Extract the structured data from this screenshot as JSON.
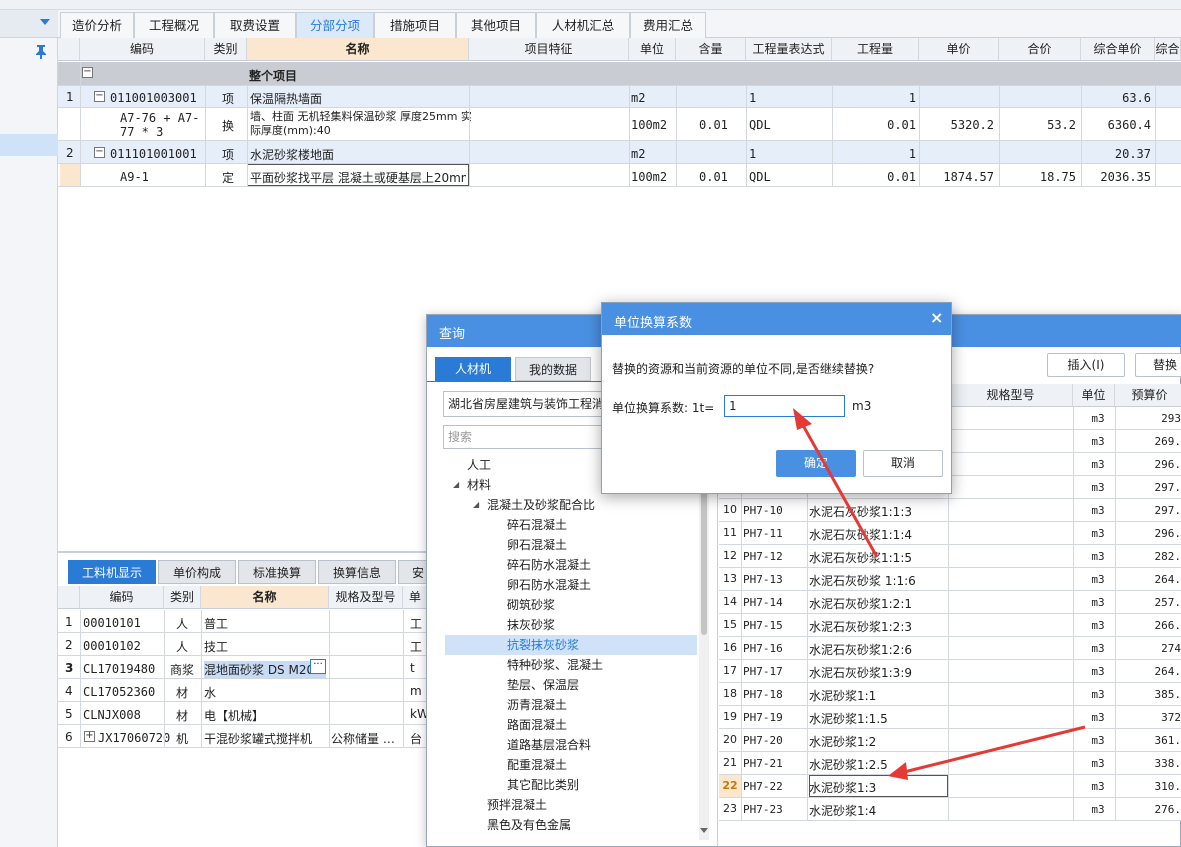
{
  "top_tabs": [
    {
      "label": "造价分析"
    },
    {
      "label": "工程概况"
    },
    {
      "label": "取费设置"
    },
    {
      "label": "分部分项"
    },
    {
      "label": "措施项目"
    },
    {
      "label": "其他项目"
    },
    {
      "label": "人材机汇总"
    },
    {
      "label": "费用汇总"
    }
  ],
  "active_top_tab": "分部分项",
  "grid": {
    "headers": [
      "编码",
      "类别",
      "名称",
      "项目特征",
      "单位",
      "含量",
      "工程量表达式",
      "工程量",
      "单价",
      "合价",
      "综合单价",
      "综合"
    ],
    "group_title": "整个项目",
    "rows": [
      {
        "no": "1",
        "code": "011001003001",
        "cat": "项",
        "name": "保温隔热墙面",
        "unit": "m2",
        "content": "",
        "expr": "1",
        "qty": "1",
        "price": "",
        "total": "",
        "uprice": "63.6"
      },
      {
        "no": "",
        "code": "A7-76 + A7-77 * 3",
        "cat": "换",
        "name": "墙、柱面 无机轻集料保温砂浆 厚度25mm 实际厚度(mm):40",
        "unit": "100m2",
        "content": "0.01",
        "expr": "QDL",
        "qty": "0.01",
        "price": "5320.2",
        "total": "53.2",
        "uprice": "6360.4"
      },
      {
        "no": "2",
        "code": "011101001001",
        "cat": "项",
        "name": "水泥砂浆楼地面",
        "unit": "m2",
        "content": "",
        "expr": "1",
        "qty": "1",
        "price": "",
        "total": "",
        "uprice": "20.37"
      },
      {
        "no": "",
        "code": "A9-1",
        "cat": "定",
        "name": "平面砂浆找平层 混凝土或硬基层上20mm",
        "unit": "100m2",
        "content": "0.01",
        "expr": "QDL",
        "qty": "0.01",
        "price": "1874.57",
        "total": "18.75",
        "uprice": "2036.35"
      }
    ]
  },
  "bottom": {
    "tabs": [
      "工料机显示",
      "单价构成",
      "标准换算",
      "换算信息",
      "安"
    ],
    "headers": [
      "编码",
      "类别",
      "名称",
      "规格及型号",
      "单"
    ],
    "rows": [
      {
        "no": "1",
        "code": "00010101",
        "cat": "人",
        "name": "普工",
        "spec": "",
        "unit": "工"
      },
      {
        "no": "2",
        "code": "00010102",
        "cat": "人",
        "name": "技工",
        "spec": "",
        "unit": "工"
      },
      {
        "no": "3",
        "code": "CL17019480",
        "cat": "商浆",
        "name": "混地面砂浆 DS M20",
        "spec": "",
        "unit": "t"
      },
      {
        "no": "4",
        "code": "CL17052360",
        "cat": "材",
        "name": "水",
        "spec": "",
        "unit": "m"
      },
      {
        "no": "5",
        "code": "CLNJX008",
        "cat": "材",
        "name": "电【机械】",
        "spec": "",
        "unit": "kW"
      },
      {
        "no": "6",
        "code": "JX17060720",
        "cat": "机",
        "name": "干混砂浆罐式搅拌机",
        "spec": "公称储量 …",
        "unit": "台"
      }
    ]
  },
  "query": {
    "title": "查询",
    "tabs": [
      "人材机",
      "我的数据"
    ],
    "library": "湖北省房屋建筑与装饰工程消",
    "search_placeholder": "搜索",
    "insert_btn": "插入(I)",
    "replace_btn": "替换",
    "tree": [
      {
        "label": "人工",
        "level": 1
      },
      {
        "label": "材料",
        "level": 1,
        "toggle": "◢"
      },
      {
        "label": "混凝土及砂浆配合比",
        "level": 2,
        "toggle": "◢"
      },
      {
        "label": "碎石混凝土",
        "level": 3
      },
      {
        "label": "卵石混凝土",
        "level": 3
      },
      {
        "label": "碎石防水混凝土",
        "level": 3
      },
      {
        "label": "卵石防水混凝土",
        "level": 3
      },
      {
        "label": "砌筑砂浆",
        "level": 3
      },
      {
        "label": "抹灰砂浆",
        "level": 3
      },
      {
        "label": "抗裂抹灰砂浆",
        "level": 3
      },
      {
        "label": "特种砂浆、混凝土",
        "level": 3
      },
      {
        "label": "垫层、保温层",
        "level": 3
      },
      {
        "label": "沥青混凝土",
        "level": 3
      },
      {
        "label": "路面混凝土",
        "level": 3
      },
      {
        "label": "道路基层混合料",
        "level": 3
      },
      {
        "label": "配重混凝土",
        "level": 3
      },
      {
        "label": "其它配比类别",
        "level": 3
      },
      {
        "label": "预拌混凝土",
        "level": 2
      },
      {
        "label": "黑色及有色金属",
        "level": 2
      }
    ],
    "selected_tree": "抗裂抹灰砂浆",
    "result_headers": [
      "规格型号",
      "单位",
      "预算价"
    ],
    "results": [
      {
        "no": "",
        "code": "",
        "name": "",
        "unit": "m3",
        "price": "293"
      },
      {
        "no": "",
        "code": "",
        "name": "",
        "unit": "m3",
        "price": "269."
      },
      {
        "no": "",
        "code": "",
        "name": "",
        "unit": "m3",
        "price": "296."
      },
      {
        "no": "",
        "code": "",
        "name": "",
        "unit": "m3",
        "price": "297."
      },
      {
        "no": "10",
        "code": "PH7-10",
        "name": "水泥石灰砂浆1:1:3",
        "unit": "m3",
        "price": "297."
      },
      {
        "no": "11",
        "code": "PH7-11",
        "name": "水泥石灰砂浆1:1:4",
        "unit": "m3",
        "price": "296."
      },
      {
        "no": "12",
        "code": "PH7-12",
        "name": "水泥石灰砂浆1:1:5",
        "unit": "m3",
        "price": "282."
      },
      {
        "no": "13",
        "code": "PH7-13",
        "name": "水泥石灰砂浆 1:1:6",
        "unit": "m3",
        "price": "264."
      },
      {
        "no": "14",
        "code": "PH7-14",
        "name": "水泥石灰砂浆1:2:1",
        "unit": "m3",
        "price": "257."
      },
      {
        "no": "15",
        "code": "PH7-15",
        "name": "水泥石灰砂浆1:2:3",
        "unit": "m3",
        "price": "266."
      },
      {
        "no": "16",
        "code": "PH7-16",
        "name": "水泥石灰砂浆1:2:6",
        "unit": "m3",
        "price": "274"
      },
      {
        "no": "17",
        "code": "PH7-17",
        "name": "水泥石灰砂浆1:3:9",
        "unit": "m3",
        "price": "264."
      },
      {
        "no": "18",
        "code": "PH7-18",
        "name": "水泥砂浆1:1",
        "unit": "m3",
        "price": "385."
      },
      {
        "no": "19",
        "code": "PH7-19",
        "name": "水泥砂浆1:1.5",
        "unit": "m3",
        "price": "372"
      },
      {
        "no": "20",
        "code": "PH7-20",
        "name": "水泥砂浆1:2",
        "unit": "m3",
        "price": "361."
      },
      {
        "no": "21",
        "code": "PH7-21",
        "name": "水泥砂浆1:2.5",
        "unit": "m3",
        "price": "338."
      },
      {
        "no": "22",
        "code": "PH7-22",
        "name": "水泥砂浆1:3",
        "unit": "m3",
        "price": "310."
      },
      {
        "no": "23",
        "code": "PH7-23",
        "name": "水泥砂浆1:4",
        "unit": "m3",
        "price": "276."
      }
    ]
  },
  "unit_dialog": {
    "title": "单位换算系数",
    "message": "替换的资源和当前资源的单位不同,是否继续替换?",
    "label": "单位换算系数:  1t=",
    "value": "1",
    "unit": "m3",
    "ok": "确定",
    "cancel": "取消"
  },
  "colors": {
    "accent": "#2a7bd6",
    "dialog_title": "#4a90e2",
    "arrow": "#e53935"
  }
}
